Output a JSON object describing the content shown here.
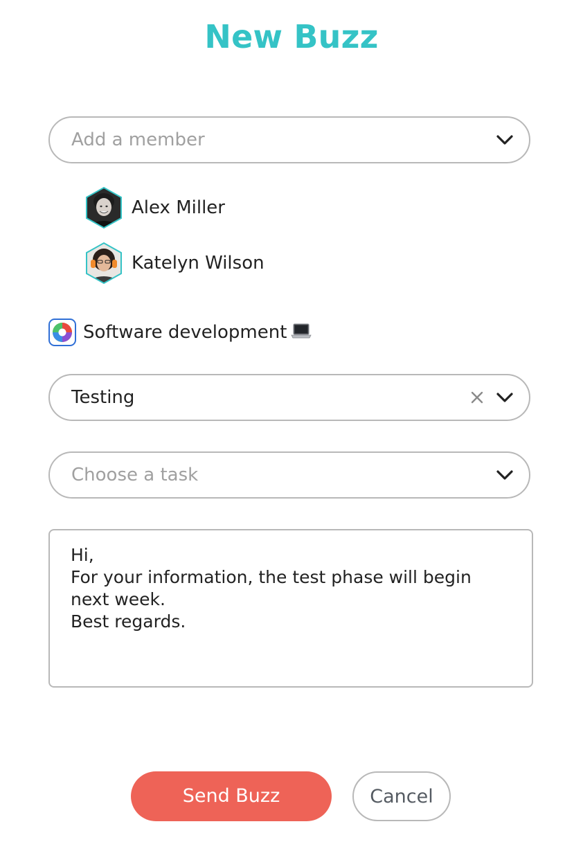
{
  "header": {
    "title": "New Buzz"
  },
  "member_select": {
    "placeholder": "Add a member"
  },
  "members": [
    {
      "name": "Alex Miller",
      "avatar_icon": "avatar-alex-miller"
    },
    {
      "name": "Katelyn Wilson",
      "avatar_icon": "avatar-katelyn-wilson"
    }
  ],
  "project": {
    "name": "Software development",
    "logo_icon": "color-wheel-icon",
    "emoji_icon": "laptop-icon"
  },
  "phase_select": {
    "value": "Testing"
  },
  "task_select": {
    "placeholder": "Choose a task"
  },
  "message": {
    "text": "Hi,\nFor your information, the test phase will begin\nnext week.\nBest regards."
  },
  "actions": {
    "send_label": "Send Buzz",
    "cancel_label": "Cancel"
  },
  "colors": {
    "accent": "#35c3c6",
    "send": "#ee6357",
    "border": "#b8b8b8",
    "placeholder": "#a0a0a0"
  }
}
